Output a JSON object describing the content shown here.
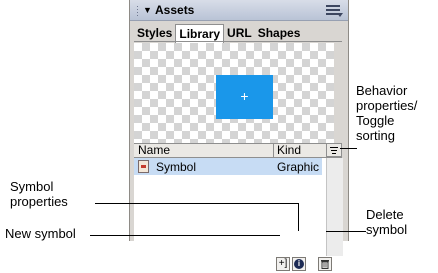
{
  "panel": {
    "title": "Assets",
    "collapse_glyph": "▼",
    "tabs": [
      {
        "label": "Styles",
        "active": false
      },
      {
        "label": "Library",
        "active": true
      },
      {
        "label": "URL",
        "active": false
      },
      {
        "label": "Shapes",
        "active": false
      }
    ],
    "preview": {
      "crosshair": "+",
      "color": "#1a97ea"
    },
    "columns": {
      "name": "Name",
      "kind": "Kind"
    },
    "rows": [
      {
        "name": "Symbol",
        "kind": "Graphic",
        "selected": true
      }
    ],
    "icons": {
      "options": "panel-options-icon",
      "sort": "sort-toggle-icon",
      "new_symbol": "new-symbol-icon",
      "properties": "info-icon",
      "delete": "trash-icon"
    },
    "button_glyphs": {
      "new_symbol": "+]",
      "properties": "i"
    }
  },
  "callouts": {
    "behavior": [
      "Behavior",
      "properties/",
      "Toggle",
      "sorting"
    ],
    "symbol_properties": [
      "Symbol",
      "properties"
    ],
    "new_symbol": "New symbol",
    "delete": [
      "Delete",
      "symbol"
    ]
  }
}
